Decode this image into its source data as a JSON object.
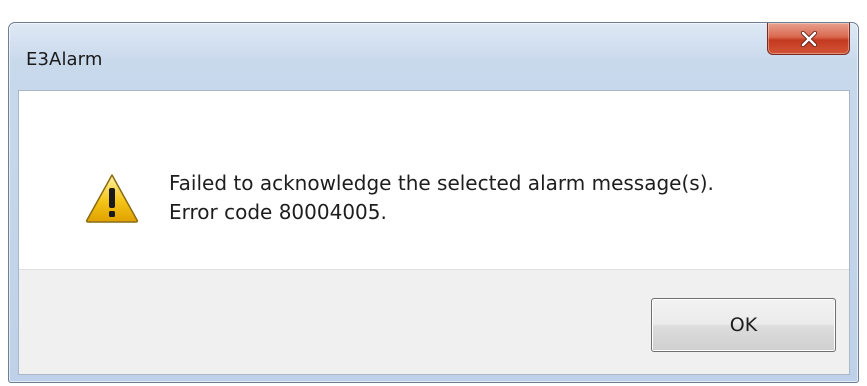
{
  "window": {
    "title": "E3Alarm",
    "close_icon": "close-icon"
  },
  "dialog": {
    "icon": "warning-icon",
    "message_line1": "Failed to acknowledge the selected alarm message(s).",
    "message_line2": "Error code 80004005.",
    "ok_label": "OK"
  },
  "colors": {
    "close_button": "#c3391f",
    "button_area_background": "#f0f0f0",
    "warning_yellow": "#f5c518"
  }
}
